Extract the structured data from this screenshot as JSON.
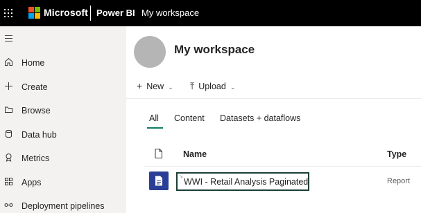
{
  "topbar": {
    "brand": "Microsoft",
    "product": "Power BI",
    "breadcrumb": "My workspace",
    "logo_colors": [
      "#f25022",
      "#7fba00",
      "#00a4ef",
      "#ffb900"
    ]
  },
  "nav": {
    "items": [
      {
        "label": "Home",
        "icon": "home-icon"
      },
      {
        "label": "Create",
        "icon": "plus-icon"
      },
      {
        "label": "Browse",
        "icon": "folder-icon"
      },
      {
        "label": "Data hub",
        "icon": "database-icon"
      },
      {
        "label": "Metrics",
        "icon": "trophy-icon"
      },
      {
        "label": "Apps",
        "icon": "apps-icon"
      },
      {
        "label": "Deployment pipelines",
        "icon": "pipeline-icon"
      }
    ]
  },
  "workspace": {
    "title": "My workspace"
  },
  "toolbar": {
    "new_label": "New",
    "upload_label": "Upload"
  },
  "tabs": [
    {
      "label": "All",
      "active": true
    },
    {
      "label": "Content",
      "active": false
    },
    {
      "label": "Datasets + dataflows",
      "active": false
    }
  ],
  "table": {
    "columns": [
      "Name",
      "Type"
    ],
    "rows": [
      {
        "name": "WWI - Retail Analysis Paginated",
        "type": "Report"
      }
    ]
  },
  "colors": {
    "accent": "#117865",
    "report_icon_bg": "#2b3e96",
    "topbar_bg": "#000000",
    "nav_bg": "#f3f2f1"
  }
}
